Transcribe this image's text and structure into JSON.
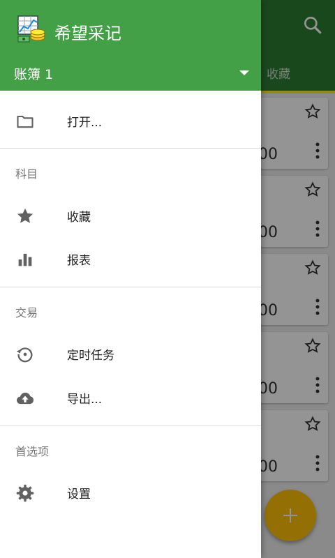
{
  "background": {
    "tab_label": "收藏",
    "card_amount": "00",
    "cards": 5
  },
  "drawer": {
    "app_name": "希望采记",
    "book_name": "账簿 1",
    "open_label": "打开...",
    "sections": {
      "accounts": "科目",
      "transactions": "交易",
      "preferences": "首选项"
    },
    "items": {
      "favorites": "收藏",
      "reports": "报表",
      "scheduled": "定时任务",
      "export": "导出...",
      "settings": "设置"
    }
  },
  "colors": {
    "header_green": "#43a047",
    "toolbar_green": "#2e7d32",
    "fab": "#ffc107",
    "icon_gray": "#616161"
  },
  "icons": [
    "folder-icon",
    "star-icon",
    "bar-chart-icon",
    "history-icon",
    "cloud-upload-icon",
    "gear-icon",
    "search-icon",
    "more-vert-icon"
  ]
}
